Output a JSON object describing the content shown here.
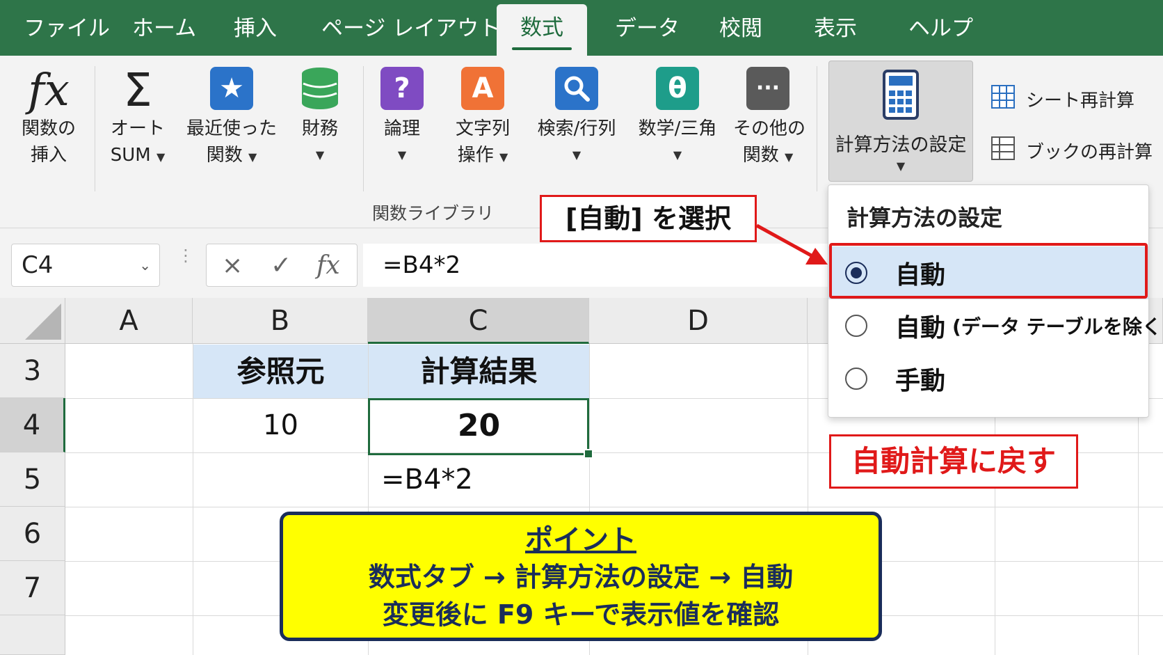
{
  "tabs": [
    {
      "label": "ファイル",
      "active": false
    },
    {
      "label": "ホーム",
      "active": false
    },
    {
      "label": "挿入",
      "active": false
    },
    {
      "label": "ページ レイアウト",
      "active": false
    },
    {
      "label": "数式",
      "active": true
    },
    {
      "label": "データ",
      "active": false
    },
    {
      "label": "校閲",
      "active": false
    },
    {
      "label": "表示",
      "active": false
    },
    {
      "label": "ヘルプ",
      "active": false
    }
  ],
  "ribbon": {
    "insert_function": {
      "icon": "fx-icon",
      "line1": "関数の",
      "line2": "挿入"
    },
    "autosum": {
      "icon": "sigma-icon",
      "line1": "オート",
      "line2": "SUM"
    },
    "recent": {
      "icon": "star-icon",
      "line1": "最近使った",
      "line2": "関数",
      "color": "#2b73c9"
    },
    "financial": {
      "icon": "coins-icon",
      "line1": "財務",
      "color": "#3aa65a"
    },
    "logical": {
      "icon": "question-icon",
      "line1": "論理",
      "color": "#7f4bc2",
      "glyph": "?"
    },
    "text": {
      "icon": "letter-a-icon",
      "line1": "文字列",
      "line2": "操作",
      "color": "#f07236",
      "glyph": "A"
    },
    "lookup": {
      "icon": "magnifier-icon",
      "line1": "検索/行列",
      "color": "#2b73c9"
    },
    "math": {
      "icon": "theta-icon",
      "line1": "数学/三角",
      "color": "#1e9d8a",
      "glyph": "θ"
    },
    "more": {
      "icon": "more-icon",
      "line1": "その他の",
      "line2": "関数",
      "color": "#5a5a5a",
      "glyph": "···"
    },
    "group_label": "関数ライブラリ",
    "calc_settings": {
      "icon": "calculator-icon",
      "line1": "計算方法の設定"
    },
    "calc_sheet": {
      "icon": "grid-sheet-icon",
      "label": "シート再計算"
    },
    "calc_book": {
      "icon": "grid-book-icon",
      "label": "ブックの再計算"
    }
  },
  "formula_bar": {
    "name_box": "C4",
    "cancel": "×",
    "enter": "✓",
    "fx": "fx",
    "formula": "=B4*2"
  },
  "columns": [
    "A",
    "B",
    "C",
    "D"
  ],
  "rows": [
    "3",
    "4",
    "5",
    "6",
    "7"
  ],
  "cells": {
    "B3": "参照元",
    "C3": "計算結果",
    "B4": "10",
    "C4": "20",
    "C5": "=B4*2"
  },
  "dropdown": {
    "title": "計算方法の設定",
    "options": [
      {
        "label": "自動",
        "sub": "",
        "selected": true
      },
      {
        "label": "自動",
        "sub": "(データ テーブルを除く)",
        "selected": false
      },
      {
        "label": "手動",
        "sub": "",
        "selected": false
      }
    ]
  },
  "callouts": {
    "select": "[自動] を選択",
    "revert": "自動計算に戻す",
    "accent": "#e01919"
  },
  "point": {
    "title": "ポイント",
    "line1": "数式タブ → 計算方法の設定 → 自動",
    "line2": "変更後に F9 キーで表示値を確認",
    "bg": "#ffff00",
    "border": "#1a2d5a"
  },
  "colors": {
    "excel_green": "#2e7549"
  }
}
